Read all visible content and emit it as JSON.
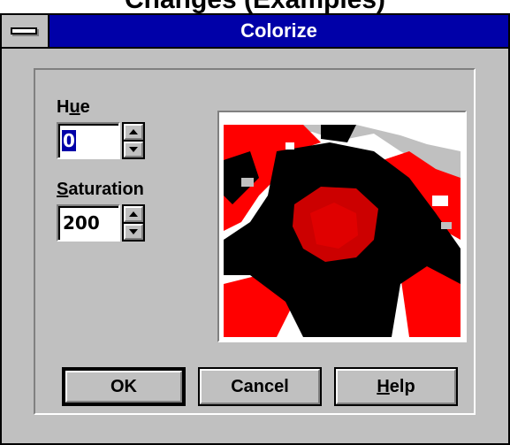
{
  "colors": {
    "titlebar": "#0000a8",
    "window_face": "#c0c0c0",
    "preview_red": "#ff0000",
    "preview_black": "#000000",
    "preview_gray": "#c0c0c0"
  },
  "top_fragment": "Changes (Examples)",
  "dialog": {
    "title": "Colorize",
    "system_menu_icon": "system-menu-bar-icon"
  },
  "hue": {
    "label_pre": "H",
    "label_mnemonic": "u",
    "label_post": "e",
    "value": "0"
  },
  "saturation": {
    "label_mnemonic": "S",
    "label_post": "aturation",
    "value": "200"
  },
  "buttons": {
    "ok": "OK",
    "cancel": "Cancel",
    "help_mnemonic": "H",
    "help_post": "elp"
  }
}
